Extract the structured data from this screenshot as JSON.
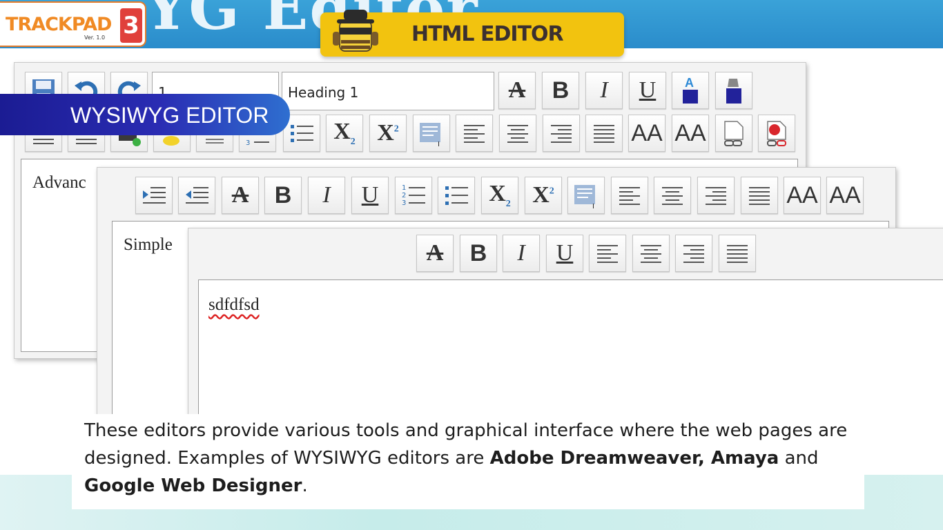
{
  "header": {
    "background_title": "YG Editor",
    "logo": {
      "text": "TRACKPAD",
      "version": "Ver. 1.0",
      "badge": "3"
    },
    "banner_title": "HTML EDITOR"
  },
  "wysiwyg_label": "WYSIWYG EDITOR",
  "advanced_editor": {
    "font_size_value": "1",
    "heading_value": "Heading 1",
    "content_text": "Advanc"
  },
  "simple_editor": {
    "content_text": "Simple"
  },
  "basic_editor": {
    "content_text": "sdfdfsd"
  },
  "caption": {
    "line1": "These editors provide various tools and graphical interface where the web pages are",
    "line2_pre": "designed. Examples of WYSIWYG editors are ",
    "bold1": "Adobe Dreamweaver, Amaya",
    "line2_mid": " and",
    "bold2": "Google Web Designer",
    "line3_post": "."
  },
  "icons": {
    "strike": "A",
    "bold": "B",
    "italic": "I",
    "underline": "U",
    "subscript": "X",
    "sub_suffix": "2",
    "superscript": "X",
    "sup_suffix": "2",
    "grow": "AA",
    "shrink": "AA"
  },
  "colors": {
    "banner_yellow": "#f2c30f",
    "top_blue": "#2a8ccb",
    "wysiwyg_navy": "#1b1c93",
    "logo_orange": "#f08a24"
  }
}
